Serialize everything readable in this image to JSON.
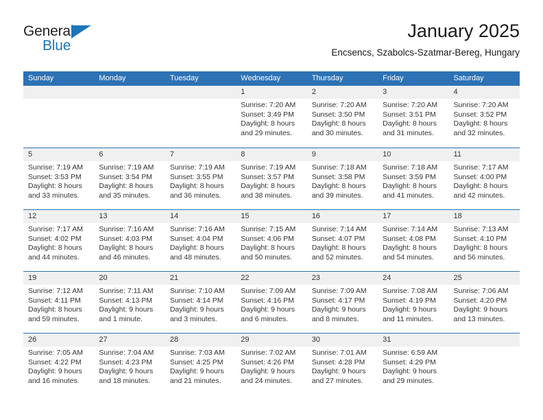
{
  "brand": {
    "name_part1": "General",
    "name_part2": "Blue",
    "triangle_icon": "triangle-icon",
    "accent_color": "#1b75bb"
  },
  "header": {
    "title": "January 2025",
    "subtitle": "Encsencs, Szabolcs-Szatmar-Bereg, Hungary"
  },
  "colors": {
    "header_blue": "#2d72b5",
    "day_band_gray": "#f0f0f0",
    "text": "#333333"
  },
  "weekday_headers": [
    "Sunday",
    "Monday",
    "Tuesday",
    "Wednesday",
    "Thursday",
    "Friday",
    "Saturday"
  ],
  "weeks": [
    [
      {
        "day": "",
        "empty": true,
        "sunrise": "",
        "sunset": "",
        "daylight_line1": "",
        "daylight_line2": ""
      },
      {
        "day": "",
        "empty": true,
        "sunrise": "",
        "sunset": "",
        "daylight_line1": "",
        "daylight_line2": ""
      },
      {
        "day": "",
        "empty": true,
        "sunrise": "",
        "sunset": "",
        "daylight_line1": "",
        "daylight_line2": ""
      },
      {
        "day": "1",
        "empty": false,
        "sunrise": "Sunrise: 7:20 AM",
        "sunset": "Sunset: 3:49 PM",
        "daylight_line1": "Daylight: 8 hours",
        "daylight_line2": "and 29 minutes."
      },
      {
        "day": "2",
        "empty": false,
        "sunrise": "Sunrise: 7:20 AM",
        "sunset": "Sunset: 3:50 PM",
        "daylight_line1": "Daylight: 8 hours",
        "daylight_line2": "and 30 minutes."
      },
      {
        "day": "3",
        "empty": false,
        "sunrise": "Sunrise: 7:20 AM",
        "sunset": "Sunset: 3:51 PM",
        "daylight_line1": "Daylight: 8 hours",
        "daylight_line2": "and 31 minutes."
      },
      {
        "day": "4",
        "empty": false,
        "sunrise": "Sunrise: 7:20 AM",
        "sunset": "Sunset: 3:52 PM",
        "daylight_line1": "Daylight: 8 hours",
        "daylight_line2": "and 32 minutes."
      }
    ],
    [
      {
        "day": "5",
        "empty": false,
        "sunrise": "Sunrise: 7:19 AM",
        "sunset": "Sunset: 3:53 PM",
        "daylight_line1": "Daylight: 8 hours",
        "daylight_line2": "and 33 minutes."
      },
      {
        "day": "6",
        "empty": false,
        "sunrise": "Sunrise: 7:19 AM",
        "sunset": "Sunset: 3:54 PM",
        "daylight_line1": "Daylight: 8 hours",
        "daylight_line2": "and 35 minutes."
      },
      {
        "day": "7",
        "empty": false,
        "sunrise": "Sunrise: 7:19 AM",
        "sunset": "Sunset: 3:55 PM",
        "daylight_line1": "Daylight: 8 hours",
        "daylight_line2": "and 36 minutes."
      },
      {
        "day": "8",
        "empty": false,
        "sunrise": "Sunrise: 7:19 AM",
        "sunset": "Sunset: 3:57 PM",
        "daylight_line1": "Daylight: 8 hours",
        "daylight_line2": "and 38 minutes."
      },
      {
        "day": "9",
        "empty": false,
        "sunrise": "Sunrise: 7:18 AM",
        "sunset": "Sunset: 3:58 PM",
        "daylight_line1": "Daylight: 8 hours",
        "daylight_line2": "and 39 minutes."
      },
      {
        "day": "10",
        "empty": false,
        "sunrise": "Sunrise: 7:18 AM",
        "sunset": "Sunset: 3:59 PM",
        "daylight_line1": "Daylight: 8 hours",
        "daylight_line2": "and 41 minutes."
      },
      {
        "day": "11",
        "empty": false,
        "sunrise": "Sunrise: 7:17 AM",
        "sunset": "Sunset: 4:00 PM",
        "daylight_line1": "Daylight: 8 hours",
        "daylight_line2": "and 42 minutes."
      }
    ],
    [
      {
        "day": "12",
        "empty": false,
        "sunrise": "Sunrise: 7:17 AM",
        "sunset": "Sunset: 4:02 PM",
        "daylight_line1": "Daylight: 8 hours",
        "daylight_line2": "and 44 minutes."
      },
      {
        "day": "13",
        "empty": false,
        "sunrise": "Sunrise: 7:16 AM",
        "sunset": "Sunset: 4:03 PM",
        "daylight_line1": "Daylight: 8 hours",
        "daylight_line2": "and 46 minutes."
      },
      {
        "day": "14",
        "empty": false,
        "sunrise": "Sunrise: 7:16 AM",
        "sunset": "Sunset: 4:04 PM",
        "daylight_line1": "Daylight: 8 hours",
        "daylight_line2": "and 48 minutes."
      },
      {
        "day": "15",
        "empty": false,
        "sunrise": "Sunrise: 7:15 AM",
        "sunset": "Sunset: 4:06 PM",
        "daylight_line1": "Daylight: 8 hours",
        "daylight_line2": "and 50 minutes."
      },
      {
        "day": "16",
        "empty": false,
        "sunrise": "Sunrise: 7:14 AM",
        "sunset": "Sunset: 4:07 PM",
        "daylight_line1": "Daylight: 8 hours",
        "daylight_line2": "and 52 minutes."
      },
      {
        "day": "17",
        "empty": false,
        "sunrise": "Sunrise: 7:14 AM",
        "sunset": "Sunset: 4:08 PM",
        "daylight_line1": "Daylight: 8 hours",
        "daylight_line2": "and 54 minutes."
      },
      {
        "day": "18",
        "empty": false,
        "sunrise": "Sunrise: 7:13 AM",
        "sunset": "Sunset: 4:10 PM",
        "daylight_line1": "Daylight: 8 hours",
        "daylight_line2": "and 56 minutes."
      }
    ],
    [
      {
        "day": "19",
        "empty": false,
        "sunrise": "Sunrise: 7:12 AM",
        "sunset": "Sunset: 4:11 PM",
        "daylight_line1": "Daylight: 8 hours",
        "daylight_line2": "and 59 minutes."
      },
      {
        "day": "20",
        "empty": false,
        "sunrise": "Sunrise: 7:11 AM",
        "sunset": "Sunset: 4:13 PM",
        "daylight_line1": "Daylight: 9 hours",
        "daylight_line2": "and 1 minute."
      },
      {
        "day": "21",
        "empty": false,
        "sunrise": "Sunrise: 7:10 AM",
        "sunset": "Sunset: 4:14 PM",
        "daylight_line1": "Daylight: 9 hours",
        "daylight_line2": "and 3 minutes."
      },
      {
        "day": "22",
        "empty": false,
        "sunrise": "Sunrise: 7:09 AM",
        "sunset": "Sunset: 4:16 PM",
        "daylight_line1": "Daylight: 9 hours",
        "daylight_line2": "and 6 minutes."
      },
      {
        "day": "23",
        "empty": false,
        "sunrise": "Sunrise: 7:09 AM",
        "sunset": "Sunset: 4:17 PM",
        "daylight_line1": "Daylight: 9 hours",
        "daylight_line2": "and 8 minutes."
      },
      {
        "day": "24",
        "empty": false,
        "sunrise": "Sunrise: 7:08 AM",
        "sunset": "Sunset: 4:19 PM",
        "daylight_line1": "Daylight: 9 hours",
        "daylight_line2": "and 11 minutes."
      },
      {
        "day": "25",
        "empty": false,
        "sunrise": "Sunrise: 7:06 AM",
        "sunset": "Sunset: 4:20 PM",
        "daylight_line1": "Daylight: 9 hours",
        "daylight_line2": "and 13 minutes."
      }
    ],
    [
      {
        "day": "26",
        "empty": false,
        "sunrise": "Sunrise: 7:05 AM",
        "sunset": "Sunset: 4:22 PM",
        "daylight_line1": "Daylight: 9 hours",
        "daylight_line2": "and 16 minutes."
      },
      {
        "day": "27",
        "empty": false,
        "sunrise": "Sunrise: 7:04 AM",
        "sunset": "Sunset: 4:23 PM",
        "daylight_line1": "Daylight: 9 hours",
        "daylight_line2": "and 18 minutes."
      },
      {
        "day": "28",
        "empty": false,
        "sunrise": "Sunrise: 7:03 AM",
        "sunset": "Sunset: 4:25 PM",
        "daylight_line1": "Daylight: 9 hours",
        "daylight_line2": "and 21 minutes."
      },
      {
        "day": "29",
        "empty": false,
        "sunrise": "Sunrise: 7:02 AM",
        "sunset": "Sunset: 4:26 PM",
        "daylight_line1": "Daylight: 9 hours",
        "daylight_line2": "and 24 minutes."
      },
      {
        "day": "30",
        "empty": false,
        "sunrise": "Sunrise: 7:01 AM",
        "sunset": "Sunset: 4:28 PM",
        "daylight_line1": "Daylight: 9 hours",
        "daylight_line2": "and 27 minutes."
      },
      {
        "day": "31",
        "empty": false,
        "sunrise": "Sunrise: 6:59 AM",
        "sunset": "Sunset: 4:29 PM",
        "daylight_line1": "Daylight: 9 hours",
        "daylight_line2": "and 29 minutes."
      },
      {
        "day": "",
        "empty": true,
        "sunrise": "",
        "sunset": "",
        "daylight_line1": "",
        "daylight_line2": ""
      }
    ]
  ]
}
